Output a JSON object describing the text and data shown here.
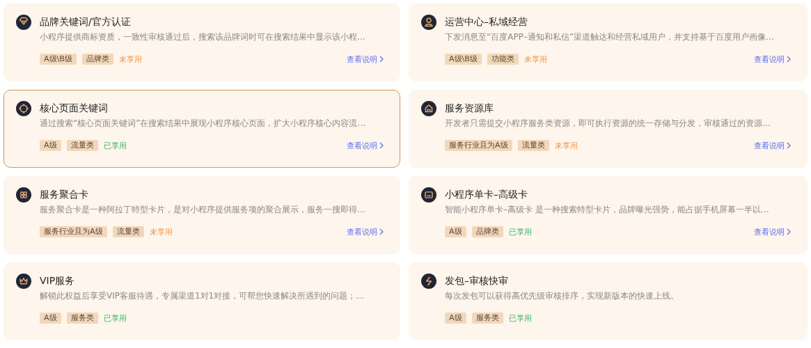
{
  "cards": [
    {
      "title": "品牌关键词/官方认证",
      "description": "小程序提供商标资质，一致性审核通过后，搜索该品牌词时可在搜索结果中显示该小程…",
      "tags": [
        "A级\\B级",
        "品牌类"
      ],
      "status": "未享用",
      "used": false,
      "selected": false,
      "link": "查看说明"
    },
    {
      "title": "运营中心–私域经营",
      "description": "下发消息至“百度APP–通知和私信”渠道触达和经营私域用户，并支持基于百度用户画像…",
      "tags": [
        "A级\\B级",
        "功能类"
      ],
      "status": "未享用",
      "used": false,
      "selected": false,
      "link": "查看说明"
    },
    {
      "title": "核心页面关键词",
      "description": "通过搜索“核心页面关键词”在搜索结果中展现小程序核心页面，扩大小程序核心内容流…",
      "tags": [
        "A级",
        "流量类"
      ],
      "status": "已享用",
      "used": true,
      "selected": true,
      "link": "查看说明"
    },
    {
      "title": "服务资源库",
      "description": "开发者只需提交小程序服务类资源，即可执行资源的统一存储与分发，审核通过的资源…",
      "tags": [
        "服务行业且为A级",
        "流量类"
      ],
      "status": "未享用",
      "used": false,
      "selected": false,
      "link": "查看说明"
    },
    {
      "title": "服务聚合卡",
      "description": "服务聚合卡是一种阿拉丁特型卡片，是对小程序提供服务项的聚合展示，服务一搜即得…",
      "tags": [
        "服务行业且为A级",
        "流量类"
      ],
      "status": "未享用",
      "used": false,
      "selected": false,
      "link": "查看说明"
    },
    {
      "title": "小程序单卡–高级卡",
      "description": "智能小程序单卡–高级卡 是一种搜索特型卡片，品牌曝光强势，能占据手机屏幕一半以…",
      "tags": [
        "A级",
        "品牌类"
      ],
      "status": "已享用",
      "used": true,
      "selected": false,
      "link": "查看说明"
    },
    {
      "title": "VIP服务",
      "description": "解锁此权益后享受VIP客服待遇，专属渠道1对1对接，可帮您快速解决所遇到的问题；…",
      "tags": [
        "A级",
        "服务类"
      ],
      "status": "已享用",
      "used": true,
      "selected": false
    },
    {
      "title": "发包–审核快审",
      "description": "每次发包可以获得高优先级审核排序，实现新版本的快速上线。",
      "tags": [
        "A级",
        "服务类"
      ],
      "status": "已享用",
      "used": true,
      "selected": false
    }
  ]
}
